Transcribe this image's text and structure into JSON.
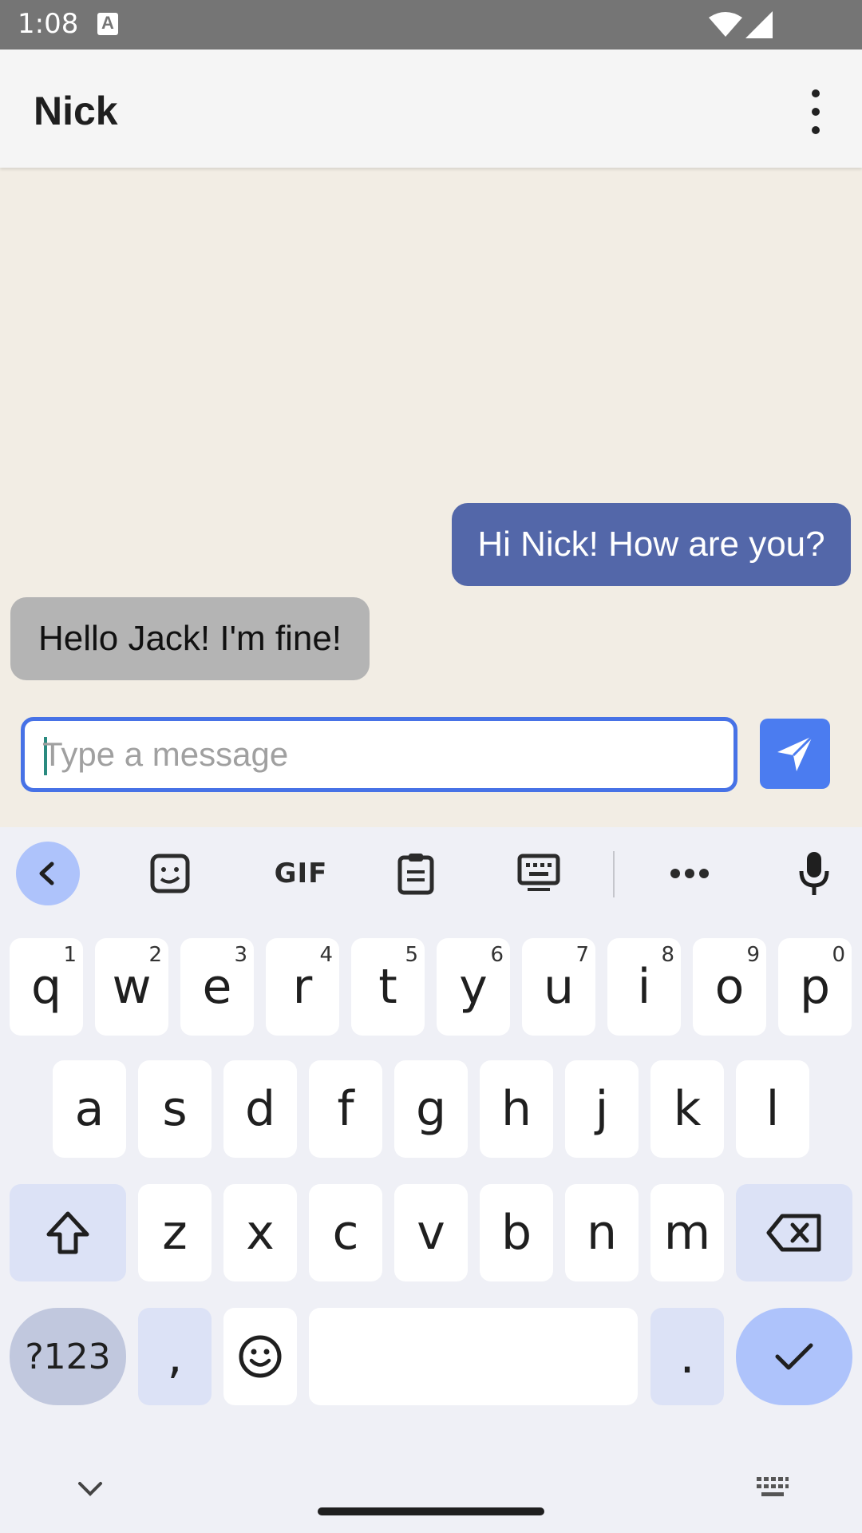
{
  "status_bar": {
    "time": "1:08",
    "notification_icon": "A"
  },
  "app_bar": {
    "title": "Nick",
    "menu_icon": "more-vert-icon"
  },
  "messages": [
    {
      "direction": "outgoing",
      "text": "Hi Nick! How are you?"
    },
    {
      "direction": "incoming",
      "text": "Hello Jack! I'm fine!"
    }
  ],
  "composer": {
    "placeholder": "Type a message",
    "value": ""
  },
  "keyboard": {
    "toolbar": [
      "back-arrow-icon",
      "sticker-icon",
      "GIF",
      "clipboard-icon",
      "keyboard-icon",
      "more-horiz-icon",
      "mic-icon"
    ],
    "gif_label": "GIF",
    "row1": [
      {
        "label": "q",
        "hint": "1"
      },
      {
        "label": "w",
        "hint": "2"
      },
      {
        "label": "e",
        "hint": "3"
      },
      {
        "label": "r",
        "hint": "4"
      },
      {
        "label": "t",
        "hint": "5"
      },
      {
        "label": "y",
        "hint": "6"
      },
      {
        "label": "u",
        "hint": "7"
      },
      {
        "label": "i",
        "hint": "8"
      },
      {
        "label": "o",
        "hint": "9"
      },
      {
        "label": "p",
        "hint": "0"
      }
    ],
    "row2": [
      "a",
      "s",
      "d",
      "f",
      "g",
      "h",
      "j",
      "k",
      "l"
    ],
    "row3": [
      "z",
      "x",
      "c",
      "v",
      "b",
      "n",
      "m"
    ],
    "row4": {
      "symbols": "?123",
      "comma": ",",
      "period": "."
    }
  },
  "colors": {
    "outgoing_bubble": "#5367a9",
    "incoming_bubble": "#b4b4b4",
    "accent": "#4b7cf0",
    "chat_bg": "#f2ede4"
  }
}
